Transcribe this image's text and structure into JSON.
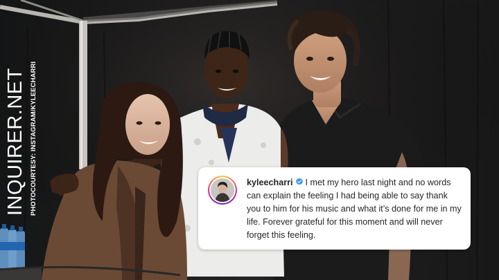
{
  "watermark": {
    "brand": "INQUIRER.NET",
    "credit": "PHOTOCOURTESY: INSTAGRAM/KYLEECHARRI"
  },
  "post": {
    "username": "kyleecharri",
    "verified_icon": "verified-badge-icon",
    "caption": "I met my hero last night and no words can explain the feeling I had being able to say thank you to him for his music and what it’s done for me in my life. Forever grateful for this moment and will never forget this feeling."
  },
  "colors": {
    "verified_blue": "#3897f0",
    "card_bg": "#ffffff",
    "text": "#262626"
  }
}
